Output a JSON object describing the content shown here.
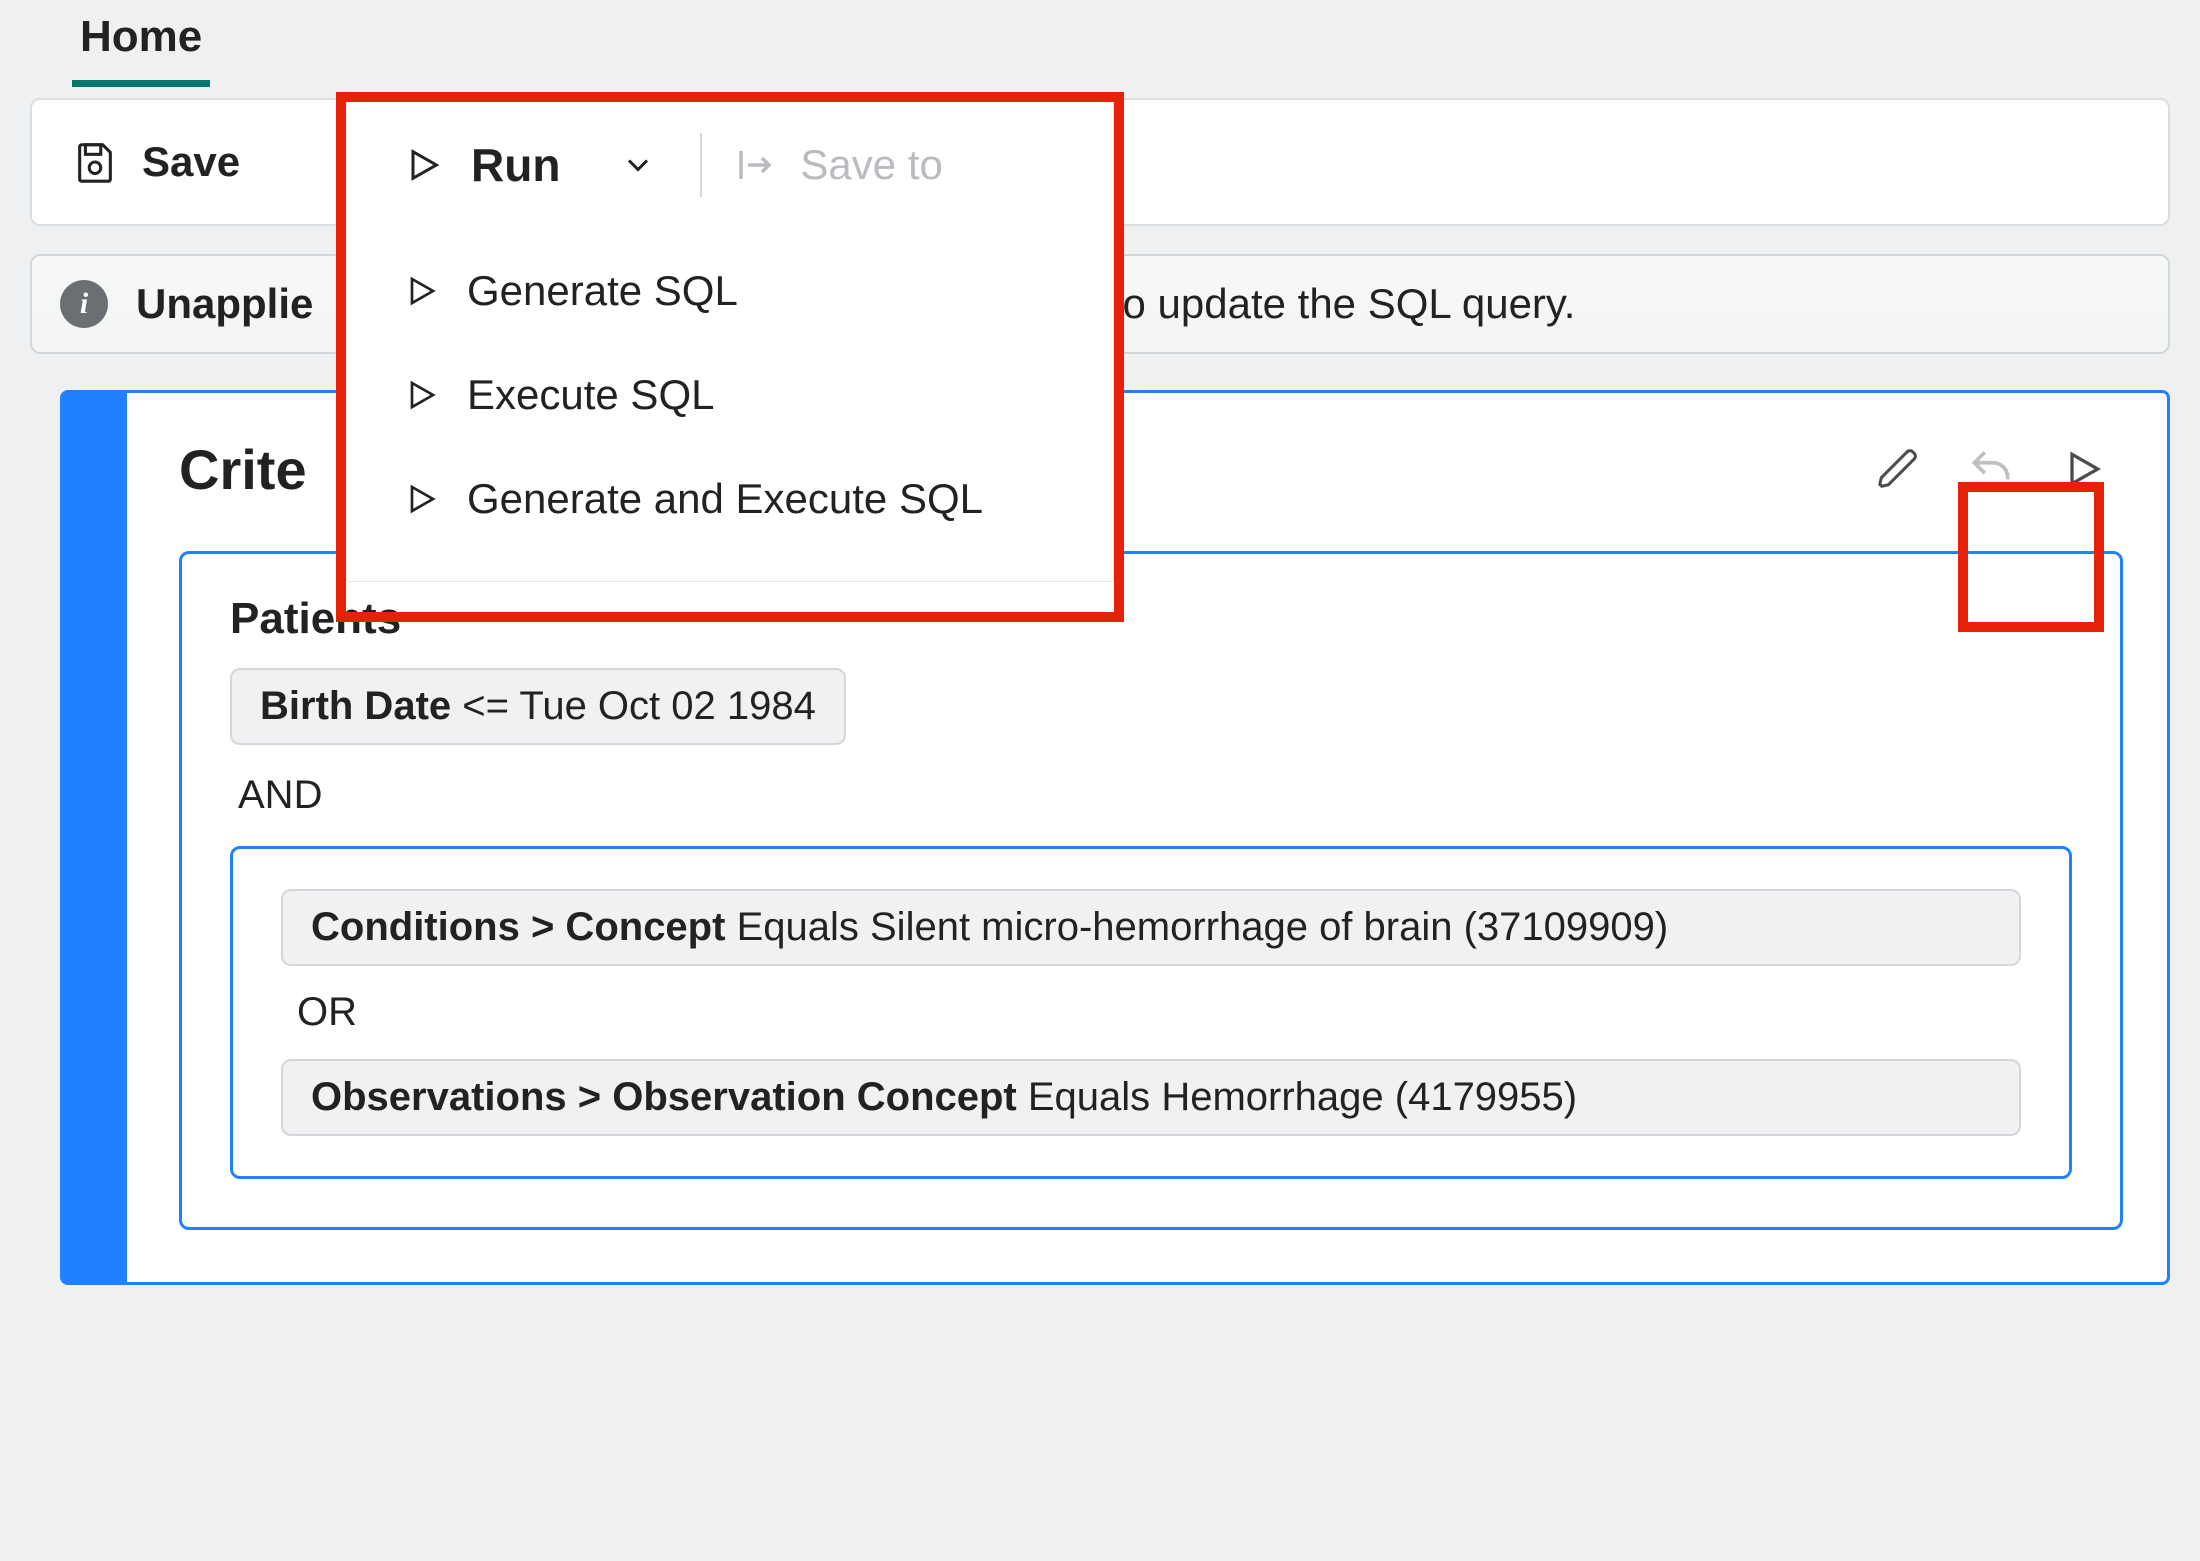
{
  "tabs": {
    "home": "Home"
  },
  "toolbar": {
    "save_label": "Save",
    "run_label": "Run",
    "save_to_label": "Save to"
  },
  "run_menu": {
    "items": [
      {
        "label": "Generate SQL"
      },
      {
        "label": "Execute SQL"
      },
      {
        "label": "Generate and Execute SQL"
      }
    ]
  },
  "banner": {
    "prefix": "Unapplie",
    "suffix": "L to update the SQL query."
  },
  "criteria": {
    "title_visible": "Crite",
    "section_title": "Patients",
    "rule1_field": "Birth Date",
    "rule1_op": "<=",
    "rule1_value": "Tue Oct 02 1984",
    "and_label": "AND",
    "or_label": "OR",
    "rule2_field": "Conditions > Concept",
    "rule2_op": "Equals",
    "rule2_value": "Silent micro-hemorrhage of brain (37109909)",
    "rule3_field": "Observations > Observation Concept",
    "rule3_op": "Equals",
    "rule3_value": "Hemorrhage (4179955)"
  }
}
